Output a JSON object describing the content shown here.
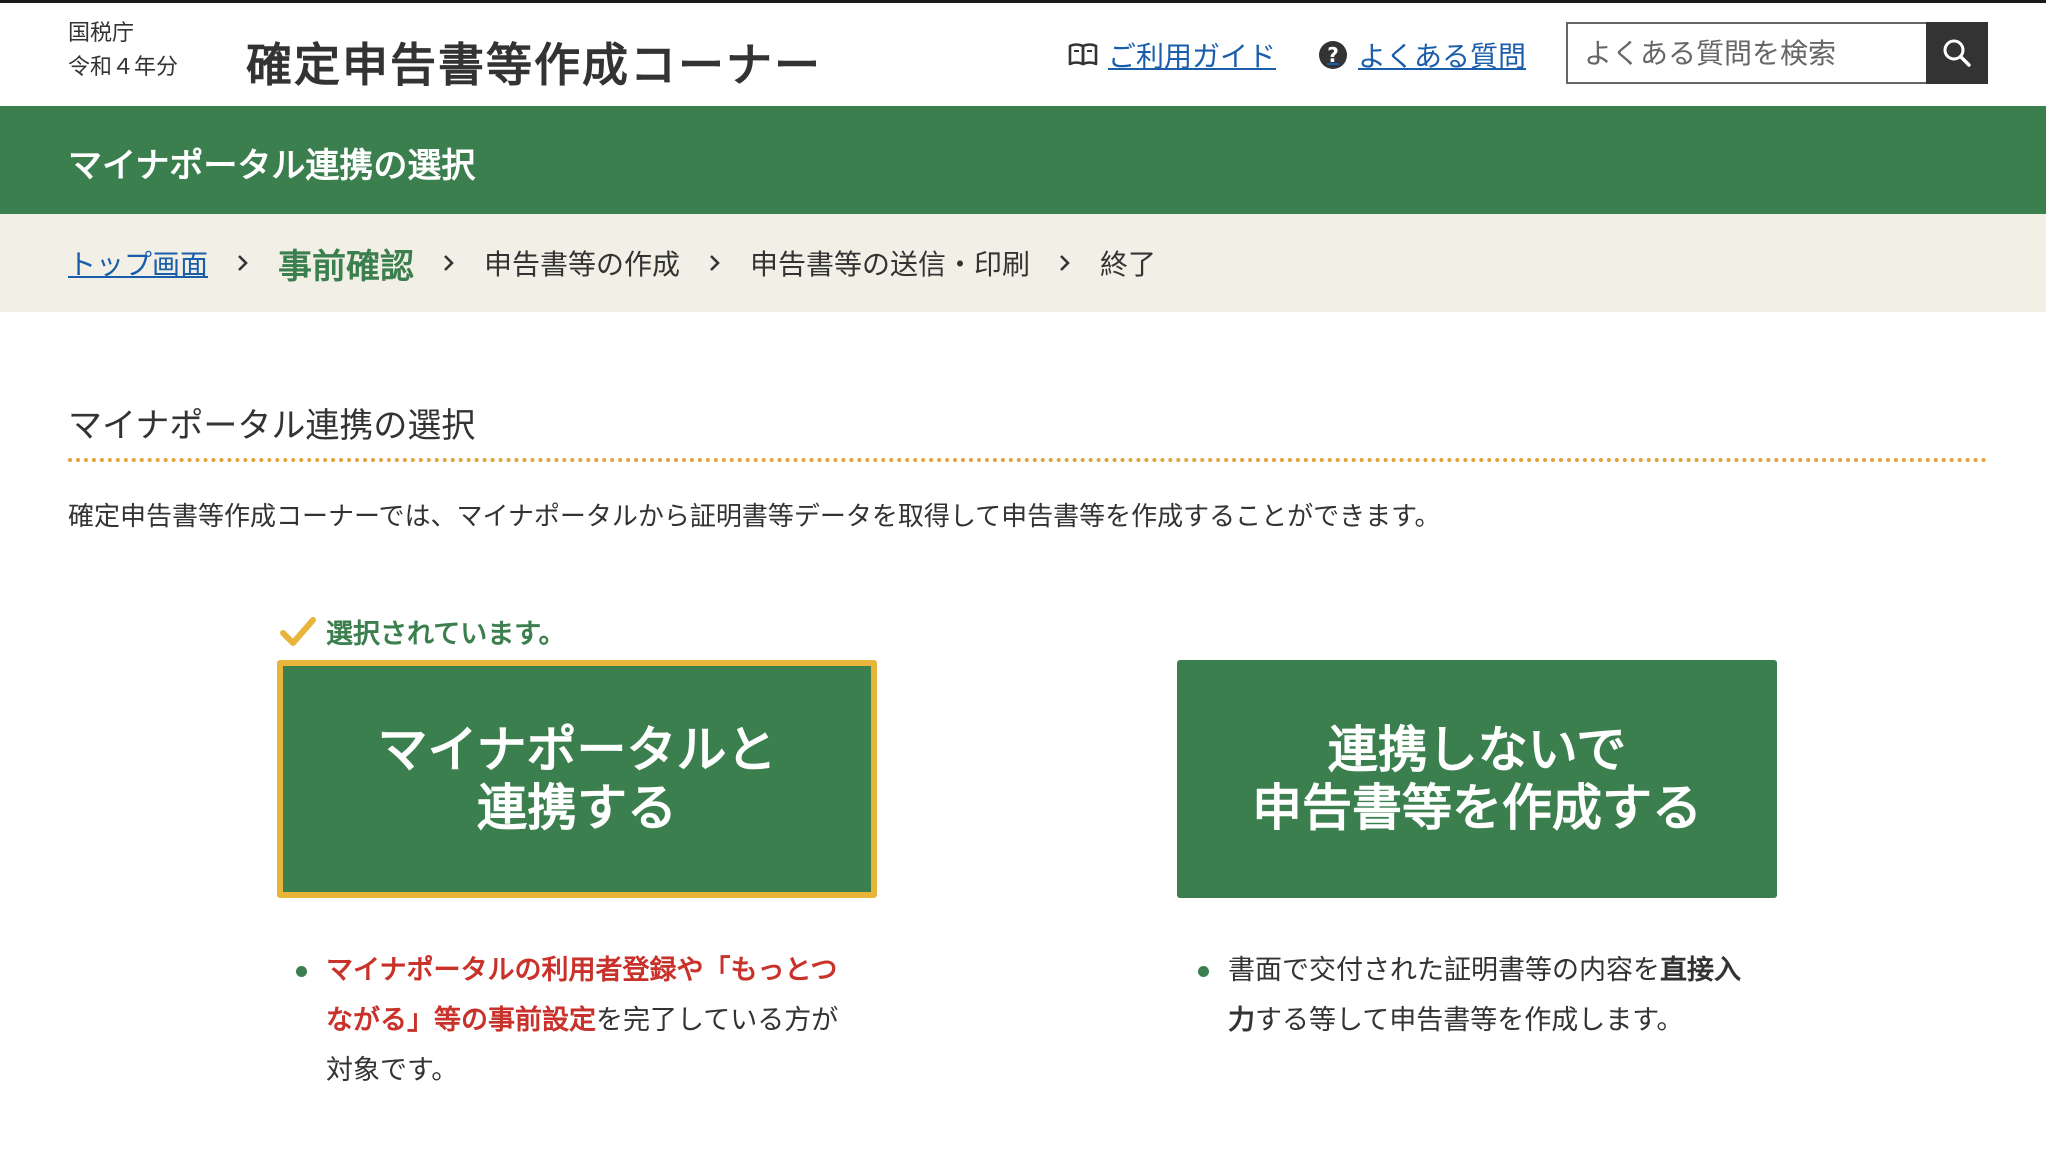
{
  "header": {
    "agency": "国税庁",
    "year": "令和４年分",
    "site_title": "確定申告書等作成コーナー",
    "guide_label": "ご利用ガイド",
    "guide_icon": "book-icon",
    "faq_label": "よくある質問",
    "faq_icon": "question-icon",
    "faq_icon_glyph": "?",
    "search_placeholder": "よくある質問を検索",
    "search_icon": "search-icon"
  },
  "greenbar": {
    "title": "マイナポータル連携の選択"
  },
  "breadcrumb": {
    "items": [
      {
        "label": "トップ画面",
        "state": "link"
      },
      {
        "label": "事前確認",
        "state": "current"
      },
      {
        "label": "申告書等の作成",
        "state": "upcoming"
      },
      {
        "label": "申告書等の送信・印刷",
        "state": "upcoming"
      },
      {
        "label": "終了",
        "state": "upcoming"
      }
    ]
  },
  "main": {
    "heading": "マイナポータル連携の選択",
    "intro": "確定申告書等作成コーナーでは、マイナポータルから証明書等データを取得して申告書等を作成することができます。",
    "selected_note": "選択されています。",
    "options": [
      {
        "label": "マイナポータルと\n連携する",
        "selected": true,
        "desc_red": "マイナポータルの利用者登録や「もっとつながる」等の事前設定",
        "desc_rest": "を完了している方が対象です。"
      },
      {
        "label": "連携しないで\n申告書等を作成する",
        "selected": false,
        "desc_pre": "書面で交付された証明書等の内容を",
        "desc_bold": "直接入力",
        "desc_rest": "する等して申告書等を作成します。"
      }
    ]
  },
  "colors": {
    "brand_green": "#3c7f4f",
    "selected_border": "#e8b43a",
    "breadcrumb_bg": "#f2f0e6",
    "link": "#1a5dab",
    "emphasis_red": "#c8322b"
  }
}
